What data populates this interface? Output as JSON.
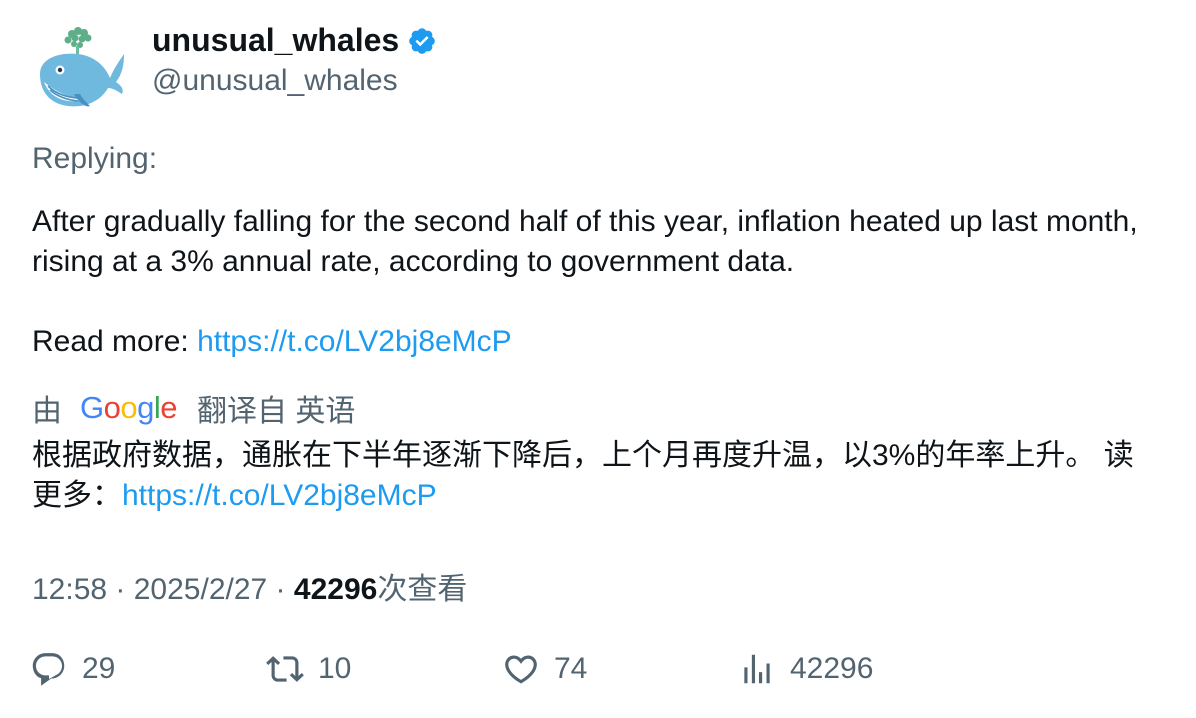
{
  "user": {
    "display_name": "unusual_whales",
    "handle": "@unusual_whales",
    "verified": true,
    "verified_color": "#1d9bf0",
    "avatar_icon": "whale-avatar-icon"
  },
  "reply": {
    "label": "Replying:"
  },
  "tweet": {
    "text": "After gradually falling for the second half of this year, inflation heated up last month, rising at a 3% annual rate, according to government data.",
    "read_more_label": "Read more: ",
    "link": "https://t.co/LV2bj8eMcP"
  },
  "translation": {
    "prefix": "由",
    "google_letters": [
      "G",
      "o",
      "o",
      "g",
      "l",
      "e"
    ],
    "suffix": "翻译自 英语",
    "text": "根据政府数据，通胀在下半年逐渐下降后，上个月再度升温，以3%的年率上升。 读更多：",
    "link": "https://t.co/LV2bj8eMcP"
  },
  "meta": {
    "time": "12:58",
    "separator": " · ",
    "date": "2025/2/27",
    "views": "42296",
    "views_label": "次查看"
  },
  "actions": {
    "replies": "29",
    "retweets": "10",
    "likes": "74",
    "views": "42296"
  },
  "colors": {
    "text": "#0f1419",
    "secondary": "#536471",
    "link": "#1d9bf0"
  }
}
